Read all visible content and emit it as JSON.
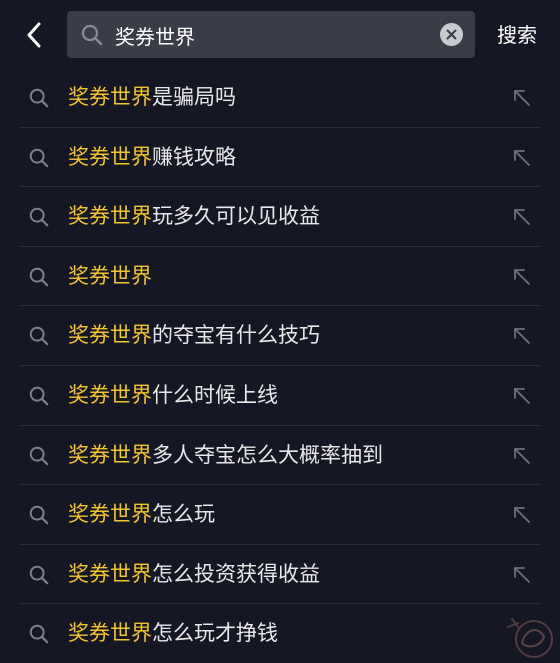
{
  "header": {
    "back_icon": "chevron-left-icon",
    "search_icon": "search-icon",
    "search_value": "奖券世界",
    "clear_icon": "clear-circle-icon",
    "submit_label": "搜索"
  },
  "colors": {
    "background": "#161724",
    "search_box": "#3a3c48",
    "highlight": "#f2c432",
    "text": "#e9e9ec",
    "icon": "#7e7f8a"
  },
  "suggestions": [
    {
      "highlight": "奖券世界",
      "rest": "是骗局吗",
      "icon": "search-icon",
      "action_icon": "arrow-up-left-icon"
    },
    {
      "highlight": "奖券世界",
      "rest": "赚钱攻略",
      "icon": "search-icon",
      "action_icon": "arrow-up-left-icon"
    },
    {
      "highlight": "奖券世界",
      "rest": "玩多久可以见收益",
      "icon": "search-icon",
      "action_icon": "arrow-up-left-icon"
    },
    {
      "highlight": "奖券世界",
      "rest": "",
      "icon": "search-icon",
      "action_icon": "arrow-up-left-icon"
    },
    {
      "highlight": "奖券世界",
      "rest": "的夺宝有什么技巧",
      "icon": "search-icon",
      "action_icon": "arrow-up-left-icon"
    },
    {
      "highlight": "奖券世界",
      "rest": "什么时候上线",
      "icon": "search-icon",
      "action_icon": "arrow-up-left-icon"
    },
    {
      "highlight": "奖券世界",
      "rest": "多人夺宝怎么大概率抽到",
      "icon": "search-icon",
      "action_icon": "arrow-up-left-icon"
    },
    {
      "highlight": "奖券世界",
      "rest": "怎么玩",
      "icon": "search-icon",
      "action_icon": "arrow-up-left-icon"
    },
    {
      "highlight": "奖券世界",
      "rest": "怎么投资获得收益",
      "icon": "search-icon",
      "action_icon": "arrow-up-left-icon"
    },
    {
      "highlight": "奖券世界",
      "rest": "怎么玩才挣钱",
      "icon": "search-icon",
      "action_icon": null
    }
  ]
}
